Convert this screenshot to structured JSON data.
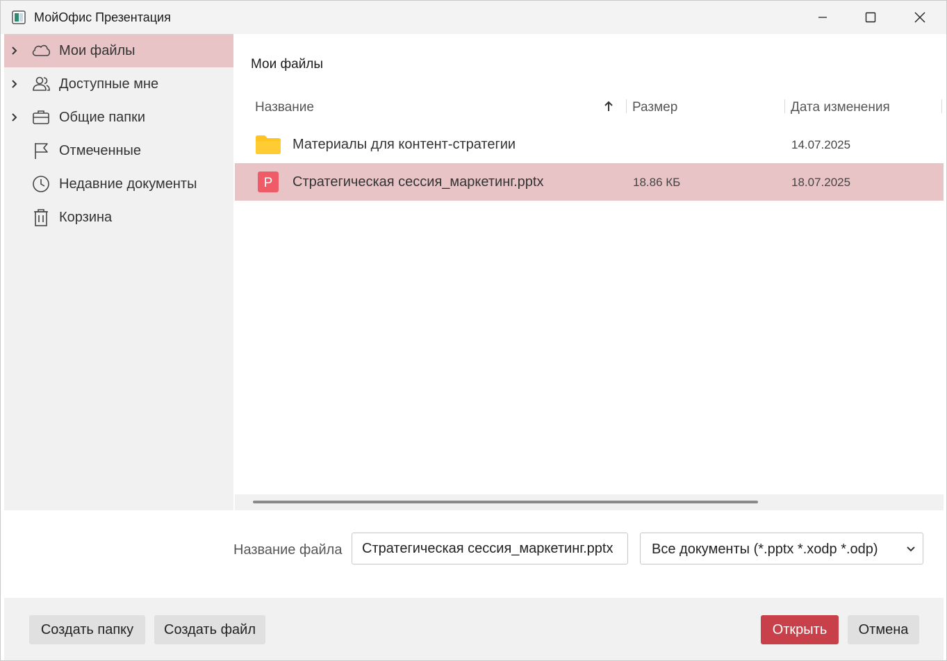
{
  "window": {
    "title": "МойОфис Презентация",
    "accent_color": "#c8404a",
    "selection_color": "#e8c4c7"
  },
  "sidebar": {
    "items": [
      {
        "label": "Мои файлы",
        "icon": "cloud-icon",
        "expandable": true,
        "active": true
      },
      {
        "label": "Доступные мне",
        "icon": "users-icon",
        "expandable": true,
        "active": false
      },
      {
        "label": "Общие папки",
        "icon": "briefcase-icon",
        "expandable": true,
        "active": false
      },
      {
        "label": "Отмеченные",
        "icon": "flag-icon",
        "expandable": false,
        "active": false
      },
      {
        "label": "Недавние документы",
        "icon": "clock-icon",
        "expandable": false,
        "active": false
      },
      {
        "label": "Корзина",
        "icon": "trash-icon",
        "expandable": false,
        "active": false
      }
    ]
  },
  "main": {
    "title": "Мои файлы",
    "columns": {
      "name": "Название",
      "size": "Размер",
      "date": "Дата изменения"
    },
    "sort": {
      "column": "name",
      "direction": "ascending"
    },
    "rows": [
      {
        "type": "folder",
        "icon": "folder-icon",
        "name": "Материалы для контент-стратегии",
        "size": "",
        "date": "14.07.2025",
        "selected": false
      },
      {
        "type": "pptx",
        "icon": "presentation-file-icon",
        "icon_letter": "P",
        "name": "Стратегическая сессия_маркетинг.pptx",
        "size": "18.86 КБ",
        "date": "18.07.2025",
        "selected": true
      }
    ]
  },
  "filename": {
    "label": "Название файла",
    "value": "Стратегическая сессия_маркетинг.pptx"
  },
  "filter": {
    "selected": "Все документы (*.pptx *.xodp *.odp)"
  },
  "buttons": {
    "create_folder": "Создать папку",
    "create_file": "Создать файл",
    "open": "Открыть",
    "cancel": "Отмена"
  }
}
